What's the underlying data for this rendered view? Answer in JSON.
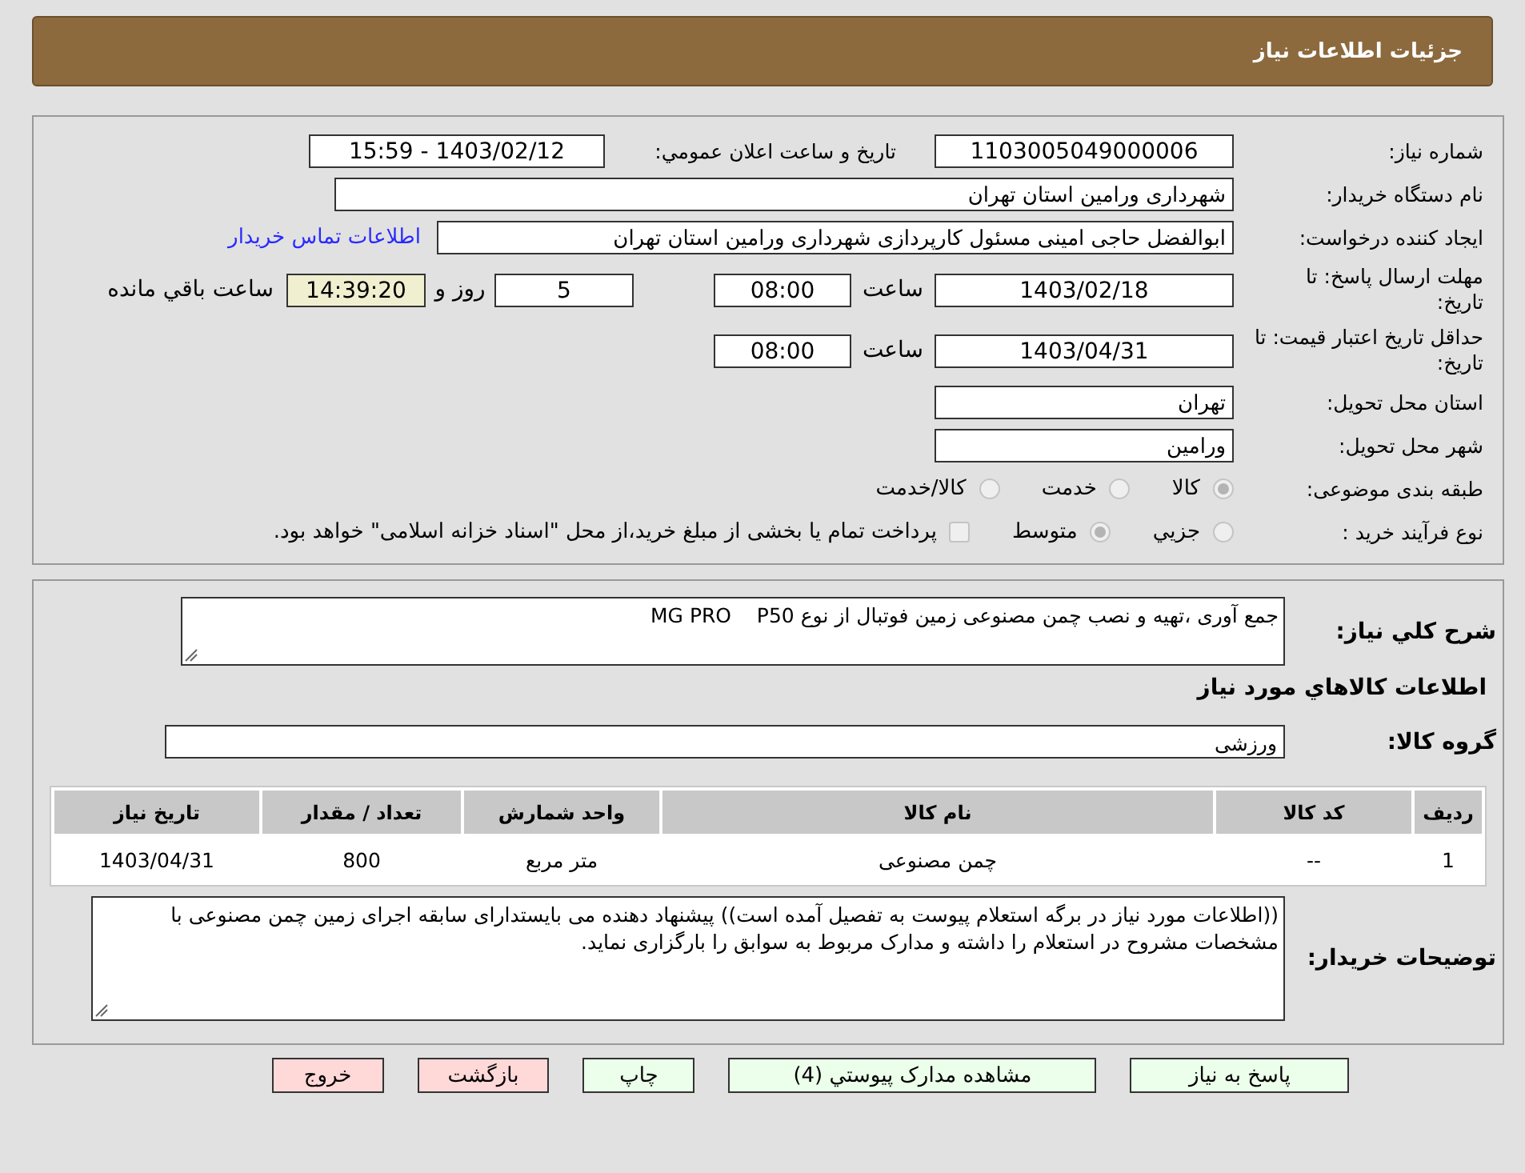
{
  "header": {
    "title": "جزئیات اطلاعات نیاز"
  },
  "need_number": {
    "label": "شماره نیاز:",
    "value": "1103005049000006"
  },
  "announce": {
    "label": "تاریخ و ساعت اعلان عمومي:",
    "value": "1403/02/12 - 15:59"
  },
  "buyer": {
    "label": "نام دستگاه خریدار:",
    "value": "شهرداری ورامین استان تهران"
  },
  "requester": {
    "label": "ایجاد کننده درخواست:",
    "value": "ابوالفضل حاجی امینی مسئول کارپردازی شهرداری ورامین استان تهران",
    "link": "اطلاعات تماس خریدار"
  },
  "deadline": {
    "label": "مهلت ارسال پاسخ: تا تاریخ:",
    "date": "1403/02/18",
    "time_label": "ساعت",
    "time": "08:00",
    "days": "5",
    "days_label": "روز و",
    "remaining": "14:39:20",
    "remaining_label": "ساعت باقي مانده"
  },
  "validity": {
    "label": "حداقل تاریخ اعتبار قیمت: تا تاریخ:",
    "date": "1403/04/31",
    "time_label": "ساعت",
    "time": "08:00"
  },
  "province": {
    "label": "استان محل تحویل:",
    "value": "تهران"
  },
  "city": {
    "label": "شهر محل تحویل:",
    "value": "ورامین"
  },
  "category": {
    "label": "طبقه بندی موضوعی:",
    "options": [
      {
        "label": "کالا",
        "selected": true
      },
      {
        "label": "خدمت",
        "selected": false
      },
      {
        "label": "کالا/خدمت",
        "selected": false
      }
    ]
  },
  "process": {
    "label": "نوع فرآیند خرید :",
    "options": [
      {
        "label": "جزيي",
        "selected": false
      },
      {
        "label": "متوسط",
        "selected": true
      }
    ],
    "checkbox": {
      "label": "پرداخت تمام یا بخشی از مبلغ خرید،از محل \"اسناد خزانه اسلامی\" خواهد بود.",
      "checked": false
    }
  },
  "summary": {
    "label": "شرح کلي نیاز:",
    "value": "جمع آوری ،تهیه و نصب چمن مصنوعی زمین فوتبال از نوع MG PRO    P50"
  },
  "goods_title": "اطلاعات کالاهاي مورد نیاز",
  "group": {
    "label": "گروه کالا:",
    "value": "ورزشی"
  },
  "table": {
    "columns": [
      "ردیف",
      "کد کالا",
      "نام کالا",
      "واحد شمارش",
      "تعداد / مقدار",
      "تاریخ نیاز"
    ],
    "rows": [
      [
        "1",
        "--",
        "چمن مصنوعی",
        "متر مربع",
        "800",
        "1403/04/31"
      ]
    ]
  },
  "notes": {
    "label": "توضیحات خریدار:",
    "value": "((اطلاعات مورد نیاز در برگه استعلام پیوست به تفصیل آمده است)) پیشنهاد دهنده می بایستدارای سابقه اجرای زمین چمن مصنوعی با مشخصات مشروح در استعلام را داشته و مدارک مربوط به سوابق را بارگزاری نماید."
  },
  "buttons": [
    {
      "label": "پاسخ به نیاز",
      "kind": "positive"
    },
    {
      "label": "مشاهده مدارک پیوستي (4)",
      "kind": "positive"
    },
    {
      "label": "چاپ",
      "kind": "positive"
    },
    {
      "label": "بازگشت",
      "kind": "negative"
    },
    {
      "label": "خروج",
      "kind": "negative"
    }
  ]
}
